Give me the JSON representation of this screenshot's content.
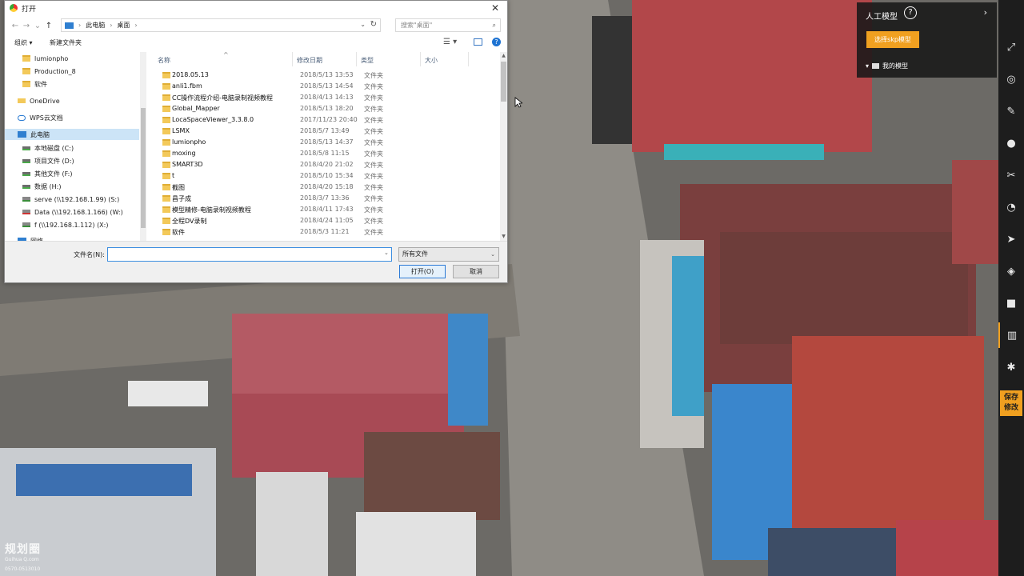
{
  "dialog": {
    "title": "打开",
    "breadcrumb": [
      "此电脑",
      "桌面"
    ],
    "search_placeholder": "搜索\"桌面\"",
    "organize_label": "组织 ▾",
    "new_folder_label": "新建文件夹",
    "columns": {
      "name": "名称",
      "date": "修改日期",
      "type": "类型",
      "size": "大小"
    },
    "nav_items": [
      {
        "label": "lumionpho",
        "icon": "folder-icon"
      },
      {
        "label": "Production_8",
        "icon": "folder-icon"
      },
      {
        "label": "软件",
        "icon": "folder-icon"
      },
      {
        "label": "OneDrive",
        "icon": "onedrive-icon"
      },
      {
        "label": "WPS云文档",
        "icon": "cloud-icon"
      },
      {
        "label": "此电脑",
        "icon": "computer-icon"
      },
      {
        "label": "本地磁盘 (C:)",
        "icon": "drive-icon"
      },
      {
        "label": "项目文件 (D:)",
        "icon": "drive-icon"
      },
      {
        "label": "其他文件 (F:)",
        "icon": "drive-icon"
      },
      {
        "label": "数据 (H:)",
        "icon": "drive-icon"
      },
      {
        "label": "serve (\\\\192.168.1.99) (S:)",
        "icon": "network-drive-icon"
      },
      {
        "label": "Data (\\\\192.168.1.166) (W:)",
        "icon": "network-drive-disconnected-icon"
      },
      {
        "label": "f (\\\\192.168.1.112) (X:)",
        "icon": "network-drive-icon"
      },
      {
        "label": "网络",
        "icon": "network-icon"
      }
    ],
    "files": [
      {
        "name": "2018.05.13",
        "date": "2018/5/13 13:53",
        "type": "文件夹"
      },
      {
        "name": "anli1.fbm",
        "date": "2018/5/13 14:54",
        "type": "文件夹"
      },
      {
        "name": "CC操作流程介绍-电脑录制视频教程",
        "date": "2018/4/13 14:13",
        "type": "文件夹"
      },
      {
        "name": "Global_Mapper",
        "date": "2018/5/13 18:20",
        "type": "文件夹"
      },
      {
        "name": "LocaSpaceViewer_3.3.8.0",
        "date": "2017/11/23 20:40",
        "type": "文件夹"
      },
      {
        "name": "LSMX",
        "date": "2018/5/7 13:49",
        "type": "文件夹"
      },
      {
        "name": "lumionpho",
        "date": "2018/5/13 14:37",
        "type": "文件夹"
      },
      {
        "name": "moxing",
        "date": "2018/5/8 11:15",
        "type": "文件夹"
      },
      {
        "name": "SMART3D",
        "date": "2018/4/20 21:02",
        "type": "文件夹"
      },
      {
        "name": "t",
        "date": "2018/5/10 15:34",
        "type": "文件夹"
      },
      {
        "name": "截图",
        "date": "2018/4/20 15:18",
        "type": "文件夹"
      },
      {
        "name": "昌子成",
        "date": "2018/3/7 13:36",
        "type": "文件夹"
      },
      {
        "name": "模型精修-电脑录制视频教程",
        "date": "2018/4/11 17:43",
        "type": "文件夹"
      },
      {
        "name": "全程DV录制",
        "date": "2018/4/24 11:05",
        "type": "文件夹"
      },
      {
        "name": "软件",
        "date": "2018/5/3 11:21",
        "type": "文件夹"
      }
    ],
    "filename_label": "文件名(N):",
    "filename_value": "",
    "filter_value": "所有文件",
    "open_label": "打开(O)",
    "cancel_label": "取消"
  },
  "model_panel": {
    "title": "人工模型",
    "help": "?",
    "chevron": "›",
    "pick_button": "选择skp模型",
    "my_models": "我的模型"
  },
  "toolbar": {
    "icons": [
      "expand-icon",
      "globe-icon",
      "ruler-icon",
      "location-pin-icon",
      "tools-icon",
      "chart-icon",
      "send-icon",
      "layers-icon",
      "cube-icon",
      "building-icon",
      "settings-icon"
    ],
    "save_line1": "保存",
    "save_line2": "修改"
  },
  "watermark": {
    "logo": "规划圈",
    "site": "Guihua Q.com",
    "phone": "0570-0513010"
  },
  "colors": {
    "accent": "#f0a020",
    "toolbar_bg": "#1d1d1d",
    "selection": "#cce4f7"
  }
}
